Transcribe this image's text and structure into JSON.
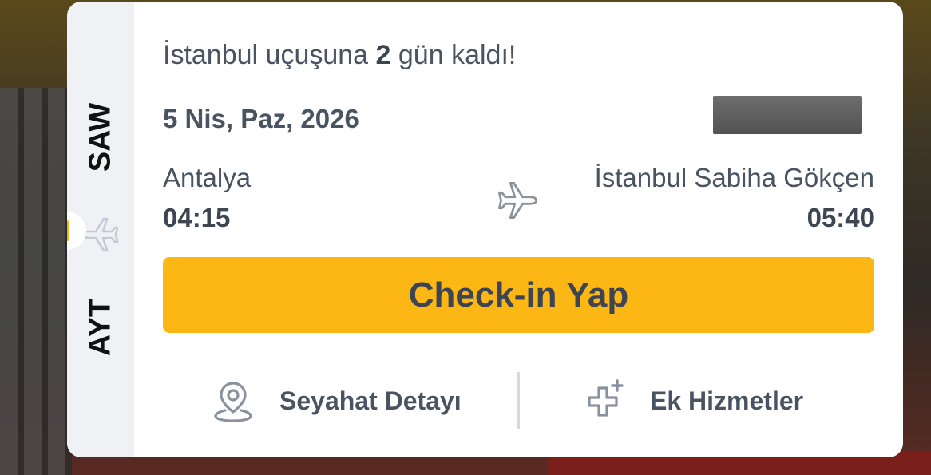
{
  "flight_card": {
    "dest_code": "SAW",
    "origin_code": "AYT",
    "countdown": {
      "prefix": "İstanbul uçuşuna ",
      "days": "2",
      "suffix": " gün kaldı!"
    },
    "date": "5 Nis, Paz, 2026",
    "origin_city": "Antalya",
    "departure_time": "04:15",
    "destination_city": "İstanbul Sabiha Gökçen",
    "arrival_time": "05:40",
    "checkin_label": "Check-in Yap",
    "travel_details_label": "Seyahat Detayı",
    "extra_services_label": "Ek Hizmetler"
  },
  "colors": {
    "accent": "#fdb714",
    "text": "#4a5362",
    "rail": "#eff1f5"
  },
  "icons": {
    "rail": "airplane-icon",
    "route": "airplane-icon",
    "travel_details": "location-pin-icon",
    "extra_services": "plus-services-icon"
  }
}
